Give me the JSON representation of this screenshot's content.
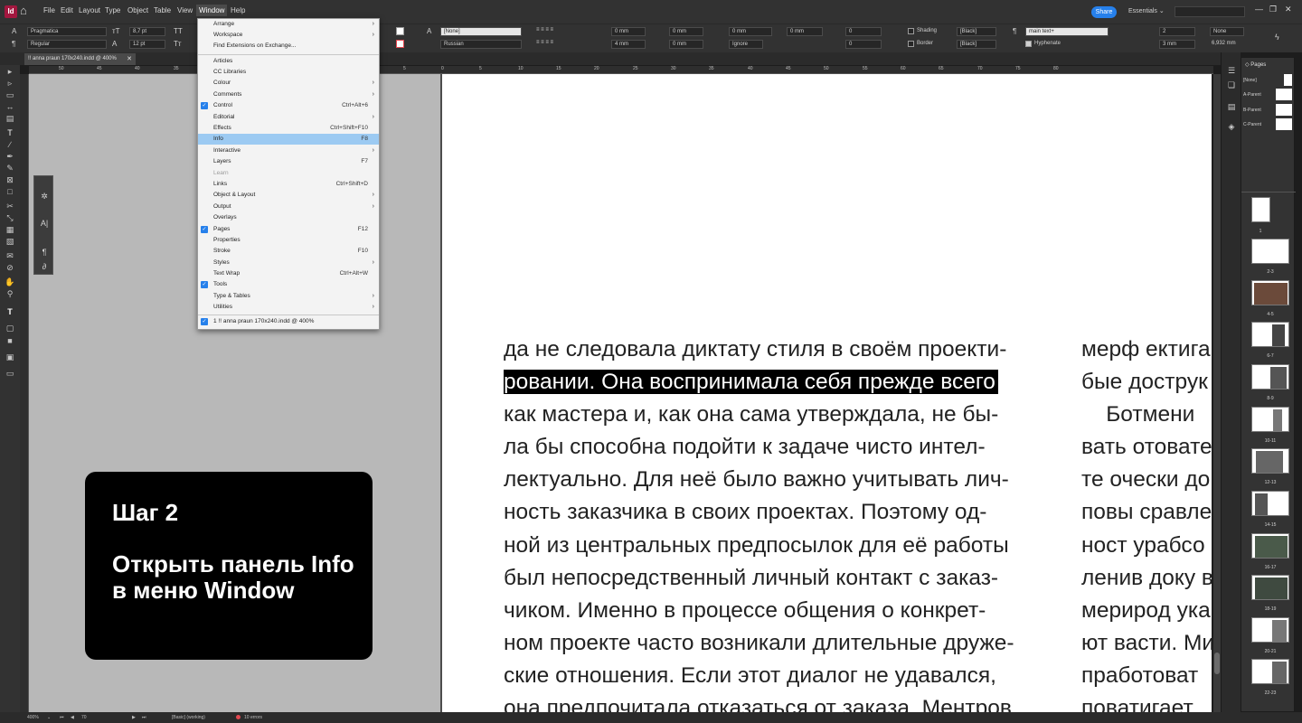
{
  "app": {
    "logo_text": "Id",
    "menu": [
      "File",
      "Edit",
      "Layout",
      "Type",
      "Object",
      "Table",
      "View",
      "Window",
      "Help"
    ],
    "active_menu": "Window",
    "share_label": "Share",
    "workspace_label": "Essentials",
    "window_controls": [
      "—",
      "❐",
      "✕"
    ]
  },
  "control_panel": {
    "font_family": "Pragmatica",
    "font_style": "Regular",
    "font_size": "8,7 pt",
    "leading": "12 pt",
    "char_style": "[None]",
    "language": "Russian",
    "offset1": "0 mm",
    "offset2": "0 mm",
    "offset3": "4 mm",
    "offset4": "0 mm",
    "offset5": "0 mm",
    "offset6": "0 mm",
    "ignore": "Ignore",
    "num1": "0",
    "num2": "0",
    "shading_label": "Shading",
    "border_label": "Border",
    "swatch1": "[Black]",
    "swatch2": "[Black]",
    "para_style": "main text+",
    "hyphenate_label": "Hyphenate",
    "cols": "2",
    "gutter": "3 mm",
    "none_label": "None",
    "width": "6,932 mm"
  },
  "doc_tab": {
    "title": "!! anna praun 170x240.indd @ 400%",
    "close": "✕"
  },
  "ruler_ticks": [
    "50",
    "45",
    "40",
    "35",
    "30",
    "25",
    "20",
    "15",
    "10",
    "5",
    "0",
    "5",
    "10",
    "15",
    "20",
    "25",
    "30",
    "35",
    "40",
    "45",
    "50",
    "55",
    "60",
    "65",
    "70",
    "75",
    "80"
  ],
  "window_menu": {
    "items": [
      {
        "label": "Arrange",
        "shortcut": "",
        "submenu": true,
        "checked": false
      },
      {
        "label": "Workspace",
        "shortcut": "",
        "submenu": true,
        "checked": false
      },
      {
        "label": "Find Extensions on Exchange...",
        "shortcut": "",
        "submenu": false,
        "checked": false
      },
      {
        "label": "Articles",
        "shortcut": "",
        "submenu": false,
        "checked": false
      },
      {
        "label": "CC Libraries",
        "shortcut": "",
        "submenu": false,
        "checked": false
      },
      {
        "label": "Colour",
        "shortcut": "",
        "submenu": true,
        "checked": false
      },
      {
        "label": "Comments",
        "shortcut": "",
        "submenu": true,
        "checked": false
      },
      {
        "label": "Control",
        "shortcut": "Ctrl+Alt+6",
        "submenu": false,
        "checked": true
      },
      {
        "label": "Editorial",
        "shortcut": "",
        "submenu": true,
        "checked": false
      },
      {
        "label": "Effects",
        "shortcut": "Ctrl+Shift+F10",
        "submenu": false,
        "checked": false
      },
      {
        "label": "Info",
        "shortcut": "F8",
        "submenu": false,
        "checked": false,
        "selected": true
      },
      {
        "label": "Interactive",
        "shortcut": "",
        "submenu": true,
        "checked": false
      },
      {
        "label": "Layers",
        "shortcut": "F7",
        "submenu": false,
        "checked": false
      },
      {
        "label": "Learn",
        "shortcut": "",
        "submenu": false,
        "checked": false,
        "disabled": true
      },
      {
        "label": "Links",
        "shortcut": "Ctrl+Shift+D",
        "submenu": false,
        "checked": false
      },
      {
        "label": "Object & Layout",
        "shortcut": "",
        "submenu": true,
        "checked": false
      },
      {
        "label": "Output",
        "shortcut": "",
        "submenu": true,
        "checked": false
      },
      {
        "label": "Overlays",
        "shortcut": "",
        "submenu": false,
        "checked": false
      },
      {
        "label": "Pages",
        "shortcut": "F12",
        "submenu": false,
        "checked": true
      },
      {
        "label": "Properties",
        "shortcut": "",
        "submenu": false,
        "checked": false
      },
      {
        "label": "Stroke",
        "shortcut": "F10",
        "submenu": false,
        "checked": false
      },
      {
        "label": "Styles",
        "shortcut": "",
        "submenu": true,
        "checked": false
      },
      {
        "label": "Text Wrap",
        "shortcut": "Ctrl+Alt+W",
        "submenu": false,
        "checked": false
      },
      {
        "label": "Tools",
        "shortcut": "",
        "submenu": false,
        "checked": true
      },
      {
        "label": "Type & Tables",
        "shortcut": "",
        "submenu": true,
        "checked": false
      },
      {
        "label": "Utilities",
        "shortcut": "",
        "submenu": true,
        "checked": false
      },
      {
        "label": "1 !! anna praun 170x240.indd @ 400%",
        "shortcut": "",
        "submenu": false,
        "checked": true
      }
    ]
  },
  "document_text": {
    "column1": [
      "да не следовала диктату стиля в своём проекти-",
      "ровании. Она воспринимала себя прежде всего",
      "как мастера и, как она сама утверждала, не бы-",
      "ла бы способна подойти к задаче чисто интел-",
      "лектуально. Для неё было важно учитывать лич-",
      "ность заказчика в своих проектах. Поэтому од-",
      "ной из центральных предпосылок для её работы",
      "был непосредственный личный контакт с заказ-",
      "чиком. Именно в процессе общения о конкрет-",
      "ном проекте часто возникали длительные друже-",
      "ские отношения. Если этот диалог не удавался,",
      "она предпочитала отказаться от заказа. Ментров"
    ],
    "highlighted_line": 1,
    "column2": [
      "мерф ектига",
      "бые дострук",
      "    Ботмени",
      "вать отовате",
      "те очески до",
      "повы сравле",
      "ност урабсо",
      "ленив доку в",
      "мерирод ука",
      "ют васти. Ми",
      "пработоват",
      "поватигает"
    ]
  },
  "pages_panel": {
    "title": "Pages",
    "parents": [
      "[None]",
      "A-Parent",
      "B-Parent",
      "C-Parent"
    ],
    "spreads": [
      "1",
      "2-3",
      "4-5",
      "6-7",
      "8-9",
      "10-11",
      "12-13",
      "14-15",
      "16-17",
      "18-19",
      "20-21",
      "22-23"
    ]
  },
  "status_bar": {
    "zoom": "400%",
    "page": "70",
    "style": "[Basic] (working)",
    "errors": "10 errors"
  },
  "overlay": {
    "step": "Шаг 2",
    "instruction": "Открыть панель Info в меню Window"
  }
}
